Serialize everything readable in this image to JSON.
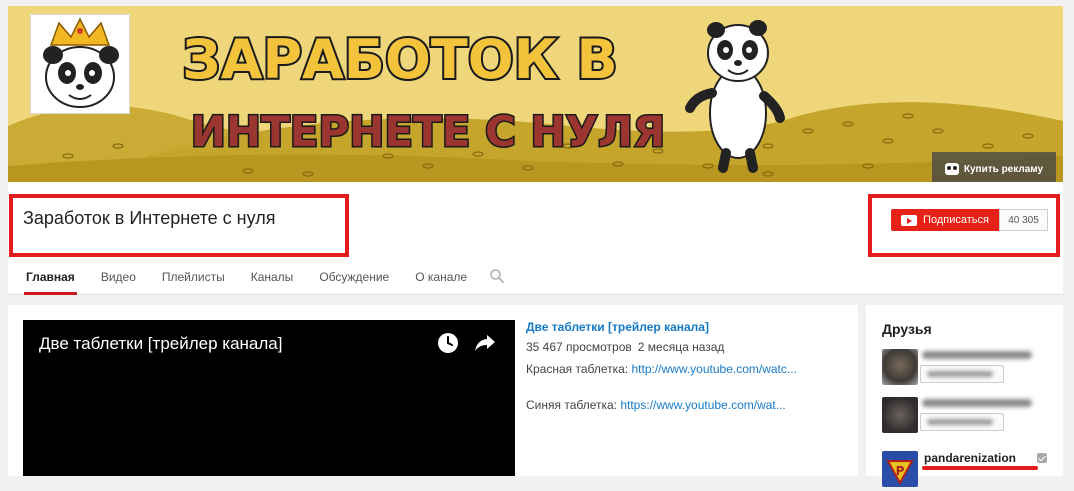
{
  "banner": {
    "headline_line1": "ЗАРАБОТОК В",
    "headline_line2": "ИНТЕРНЕТЕ С НУЛЯ",
    "buy_ad_label": "Купить рекламу"
  },
  "channel": {
    "title": "Заработок в Интернете с нуля",
    "subscribe_label": "Подписаться",
    "subscriber_count": "40 305"
  },
  "tabs": [
    {
      "label": "Главная",
      "active": true
    },
    {
      "label": "Видео"
    },
    {
      "label": "Плейлисты"
    },
    {
      "label": "Каналы"
    },
    {
      "label": "Обсуждение"
    },
    {
      "label": "О канале"
    }
  ],
  "featured_video": {
    "overlay_title": "Две таблетки [трейлер канала]",
    "link_title": "Две таблетки [трейлер канала]",
    "views": "35 467 просмотров",
    "age": "2 месяца назад",
    "desc_red_label": "Красная таблетка:",
    "desc_red_url": "http://www.youtube.com/watc...",
    "desc_blue_label": "Синяя таблетка:",
    "desc_blue_url": "https://www.youtube.com/wat..."
  },
  "sidebar": {
    "friends_title": "Друзья",
    "friends": [
      {
        "name": ""
      },
      {
        "name": ""
      },
      {
        "name": "pandarenization"
      }
    ]
  },
  "colors": {
    "accent_red": "#e62117",
    "highlight_red": "#e51c1c",
    "link_blue": "#167ac6",
    "banner_yellow": "#efd67a"
  }
}
